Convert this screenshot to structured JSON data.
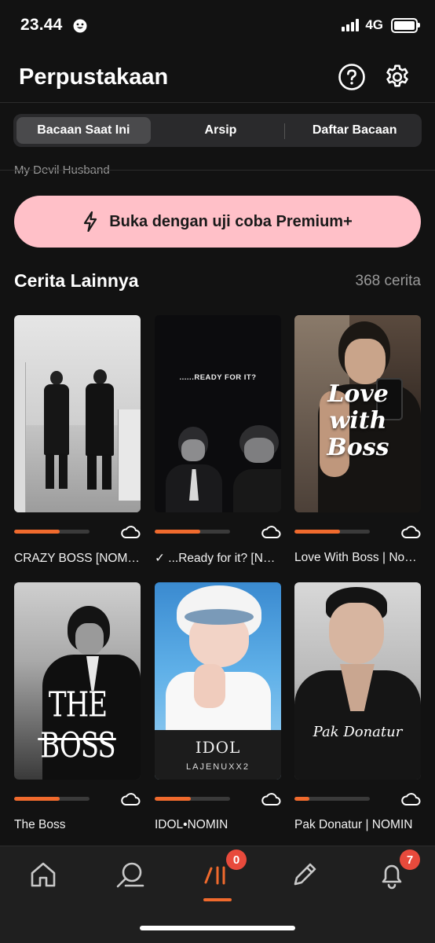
{
  "status_bar": {
    "time": "23.44",
    "network": "4G"
  },
  "header": {
    "title": "Perpustakaan",
    "help_icon": "help-icon",
    "settings_icon": "gear-icon"
  },
  "tabs": [
    {
      "label": "Bacaan Saat Ini",
      "active": true
    },
    {
      "label": "Arsip",
      "active": false
    },
    {
      "label": "Daftar Bacaan",
      "active": false
    }
  ],
  "previous_story_title": "My Devil Husband",
  "premium_button": {
    "label": "Buka dengan uji coba Premium+",
    "icon": "lightning-icon"
  },
  "section": {
    "title": "Cerita Lainnya",
    "count": "368 cerita"
  },
  "stories": [
    {
      "title": "CRAZY BOSS [NOMIN] ✓",
      "progress": 0.6,
      "cover_text": ""
    },
    {
      "title": "✓ ...Ready for it? [NOMIN]",
      "progress": 0.6,
      "cover_text": "......READY FOR IT?"
    },
    {
      "title": "Love With Boss | Nomin",
      "progress": 0.6,
      "cover_text": "Love with Boss"
    },
    {
      "title": "The Boss",
      "progress": 0.6,
      "cover_text": "THE BOSS"
    },
    {
      "title": "IDOL•NOMIN",
      "progress": 0.48,
      "cover_text": "IDOL",
      "cover_subtext": "LAJENUXX2"
    },
    {
      "title": "Pak Donatur | NOMIN",
      "progress": 0.2,
      "cover_text": "Pak Donatur"
    }
  ],
  "bottom_nav": {
    "items": [
      "home-icon",
      "search-icon",
      "library-icon",
      "pencil-icon",
      "bell-icon"
    ],
    "library_badge": "0",
    "notifications_badge": "7"
  },
  "colors": {
    "accent": "#f06a2d",
    "premium": "#ffc0c8",
    "badge": "#e84a3c",
    "background": "#121212"
  }
}
